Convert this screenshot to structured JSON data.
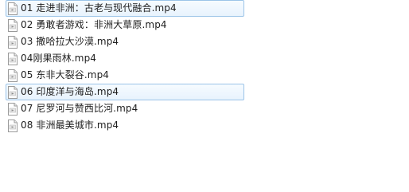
{
  "files": [
    {
      "name": "01 走进非洲：古老与现代融合.mp4",
      "selected": true
    },
    {
      "name": "02 勇敢者游戏：非洲大草原.mp4",
      "selected": false
    },
    {
      "name": "03 撒哈拉大沙漠.mp4",
      "selected": false
    },
    {
      "name": "04刚果雨林.mp4",
      "selected": false
    },
    {
      "name": "05 东非大裂谷.mp4",
      "selected": false
    },
    {
      "name": "06 印度洋与海岛.mp4",
      "selected": true
    },
    {
      "name": "07 尼罗河与赞西比河.mp4",
      "selected": false
    },
    {
      "name": "08 非洲最美城市.mp4",
      "selected": false
    }
  ],
  "icons": {
    "file": "video-file-icon"
  }
}
